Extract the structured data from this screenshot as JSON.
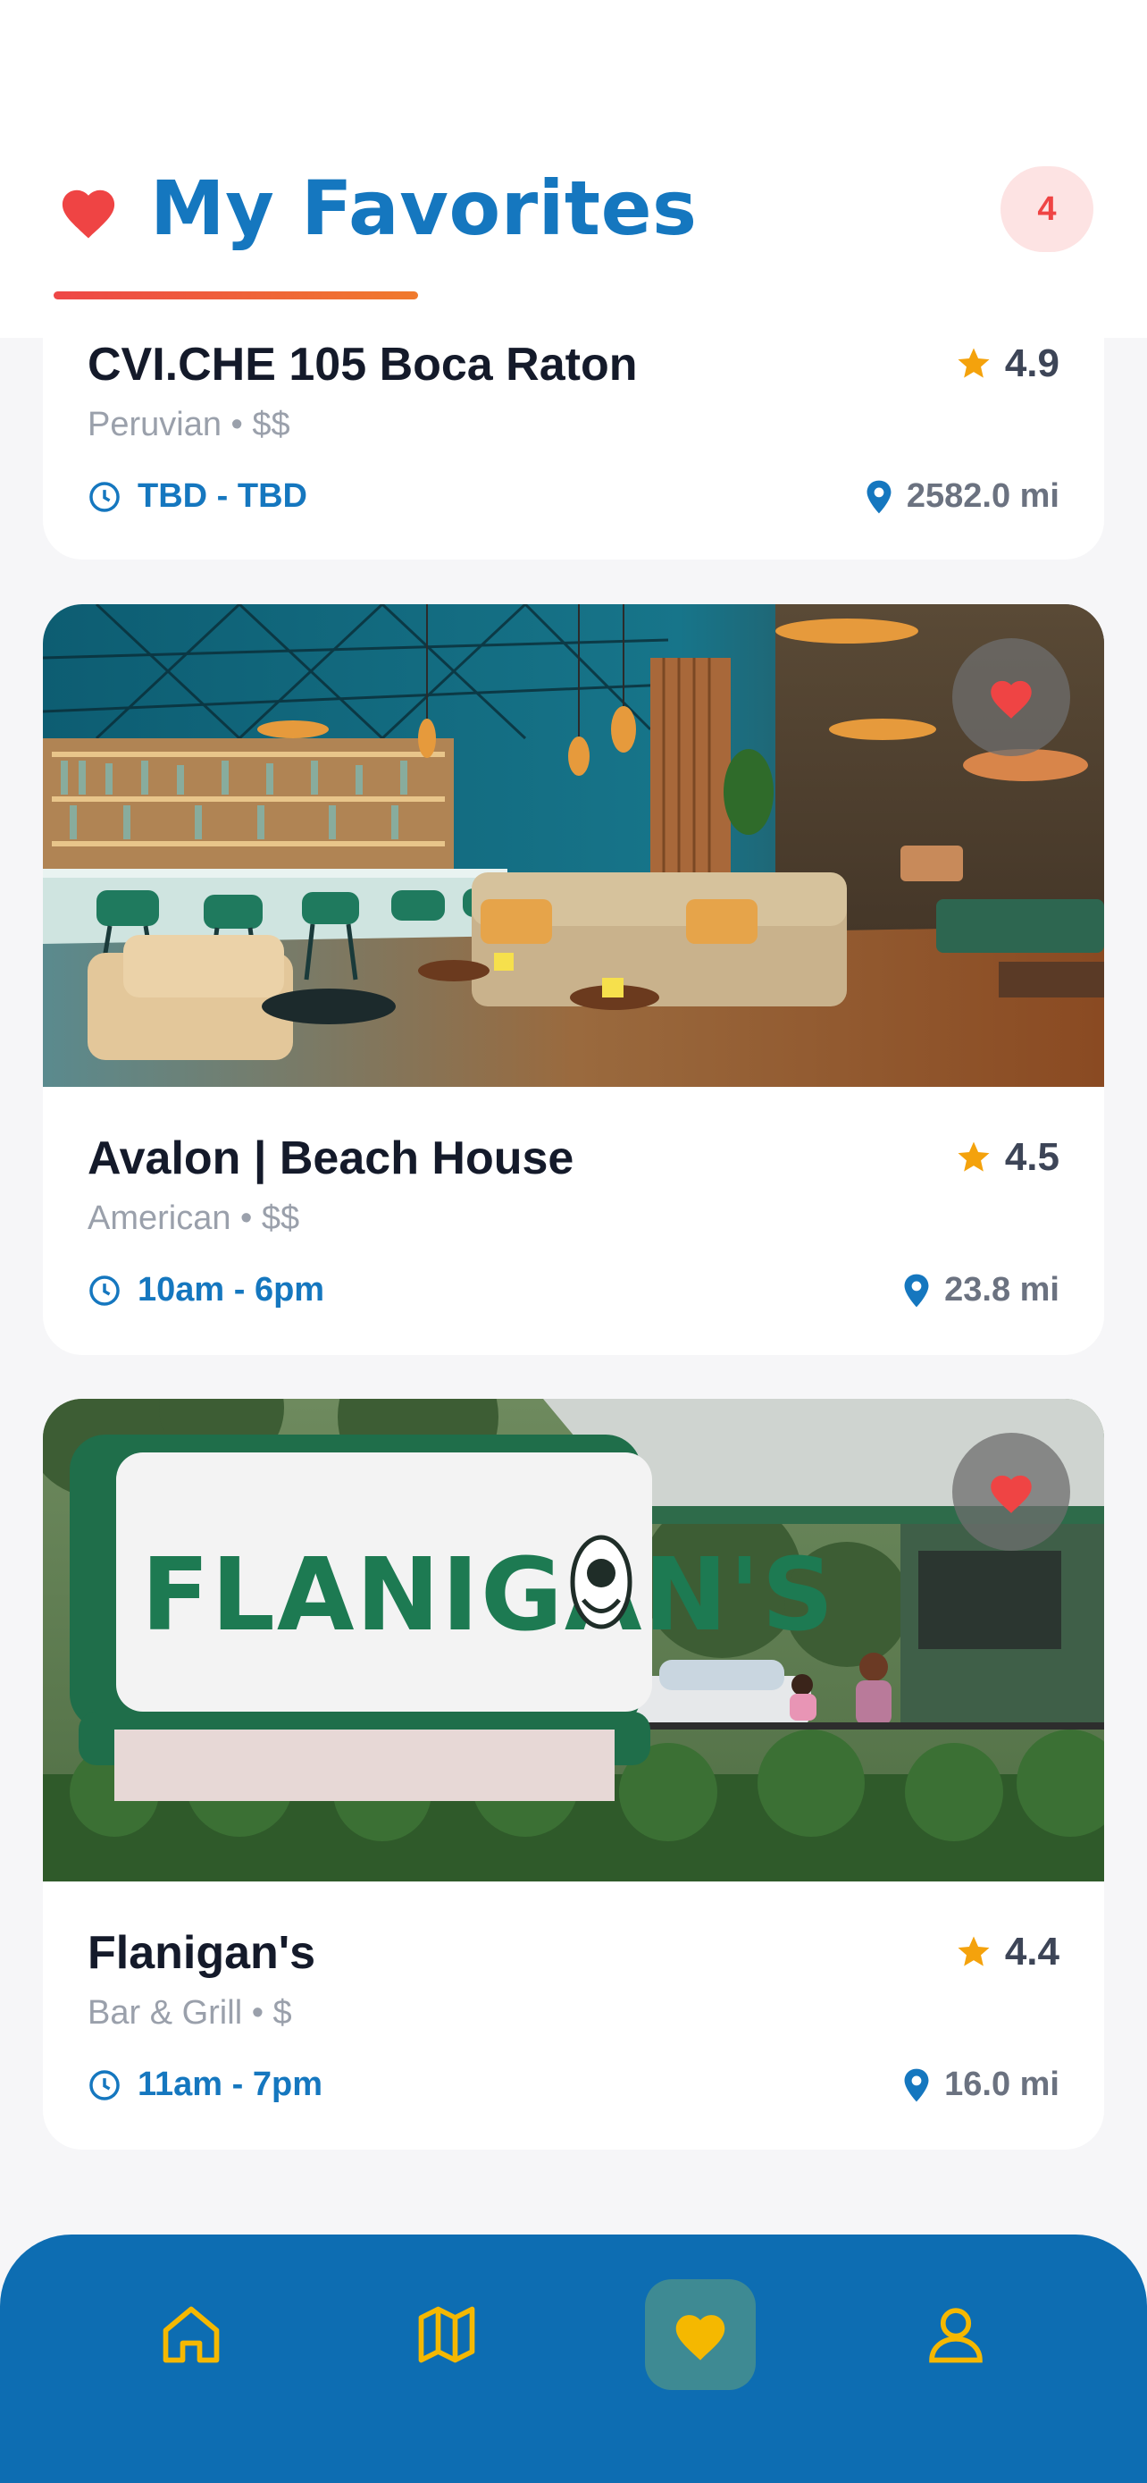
{
  "header": {
    "title": "My Favorites",
    "count": "4",
    "heart_color": "#ef4444",
    "title_color": "#1577bf"
  },
  "restaurants": [
    {
      "name": "CVI.CHE 105 Boca Raton",
      "rating": "4.9",
      "subtitle": "Peruvian • $$",
      "hours": "TBD - TBD",
      "distance": "2582.0 mi"
    },
    {
      "name": "Avalon | Beach House",
      "rating": "4.5",
      "subtitle": "American • $$",
      "hours": "10am - 6pm",
      "distance": "23.8 mi",
      "favorited": true
    },
    {
      "name": "Flanigan's",
      "rating": "4.4",
      "subtitle": "Bar & Grill • $",
      "hours": "11am - 7pm",
      "distance": "16.0 mi",
      "favorited": true,
      "sign_text": "FLANIGAN'S"
    }
  ],
  "icons": {
    "star": "star-icon",
    "clock": "clock-icon",
    "pin": "map-pin-icon",
    "heart": "heart-icon"
  },
  "nav": {
    "items": [
      "home-icon",
      "map-icon",
      "heart-icon",
      "user-icon"
    ],
    "active": "heart-icon",
    "background": "#0d6db2",
    "icon_color": "#f5b800"
  }
}
